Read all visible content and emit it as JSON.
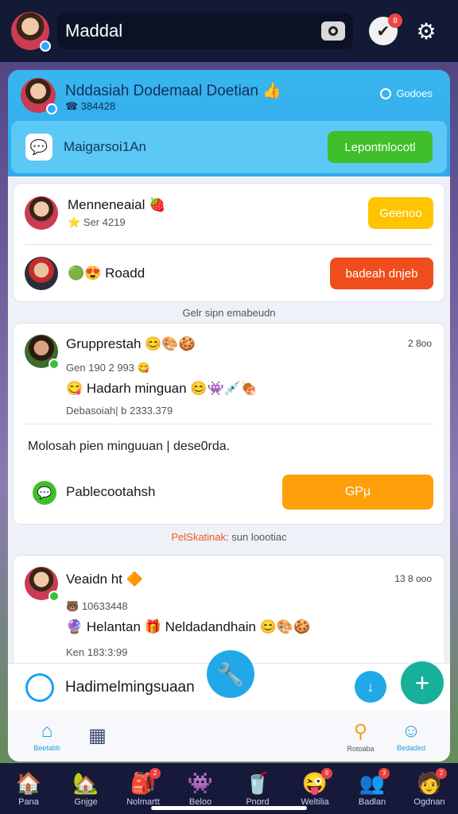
{
  "header": {
    "title": "Maddal",
    "camera_icon": "camera-icon",
    "check_icon": "check-icon",
    "notification_count": "8",
    "settings_icon": "gear-icon"
  },
  "profile": {
    "name": "Nddasiah Dodemaal Doetian",
    "emoji": "👍",
    "sub": "☎ 384428",
    "status": "Godoes",
    "row_label": "Maigarsoi1An",
    "row_button": "Lepontnlocotl"
  },
  "requests": [
    {
      "name": "Menneneaial",
      "emoji": "🍓",
      "sub": "⭐ Ser 4219",
      "button": "Geenoo"
    },
    {
      "name": "Roadd",
      "prefix_emoji": "🟢😍",
      "button": "badeah dnjeb"
    }
  ],
  "sections": {
    "label1": "Gelr sipn emabeudn",
    "label2_highlight": "PelSkatinak",
    "label2_rest": ": sun loootiac"
  },
  "post": {
    "name": "Grupprestah",
    "emojis": "😊🎨🍪",
    "time": "2 8oo",
    "sub1": "Gen 190 2 993",
    "sub1_emoji": "😋",
    "line2": "Hadarh minguan",
    "line2_emojis": "😊👾💉🍖",
    "sub2": "Debasoiah| b 2333.379",
    "long_text": "Molosah pien minguuan | dese0rda.",
    "action_label": "Pablecootahsh",
    "action_button": "GPμ"
  },
  "post2": {
    "name": "Veaidn ht",
    "emoji": "🔶",
    "time": "13 8 ooo",
    "sub1": "10633448",
    "line2a": "Helantan",
    "line2b": "Neldadandhain",
    "line2_emojis": "😊🎨🍪",
    "sub2": "Ken 183:3:99"
  },
  "bottom_bar": {
    "label": "Hadimelmingsuaan"
  },
  "tabs": [
    {
      "label": "Beetabb",
      "icon": "home-icon"
    },
    {
      "label": "",
      "icon": "store-icon"
    },
    {
      "label": "Rotoaba",
      "icon": "search-icon"
    },
    {
      "label": "Bedaded",
      "icon": "group-icon"
    }
  ],
  "dock": [
    {
      "label": "Pana",
      "icon": "🏠"
    },
    {
      "label": "Gnjge",
      "icon": "🏡",
      "badge": ""
    },
    {
      "label": "Nolmartt",
      "icon": "🎒",
      "badge": "2"
    },
    {
      "label": "Beloo",
      "icon": "👾"
    },
    {
      "label": "Pnord",
      "icon": "🥤"
    },
    {
      "label": "Weltilia",
      "icon": "😜",
      "badge": "9"
    },
    {
      "label": "Badlan",
      "icon": "👥",
      "badge": "3"
    },
    {
      "label": "Ogdnan",
      "icon": "🧑",
      "badge": "2"
    }
  ]
}
